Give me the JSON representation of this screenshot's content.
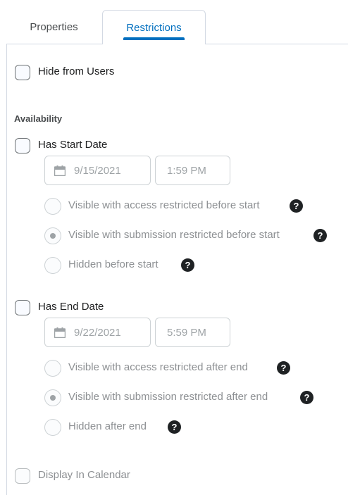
{
  "tabs": {
    "properties": "Properties",
    "restrictions": "Restrictions"
  },
  "hide_from_users": {
    "label": "Hide from Users"
  },
  "availability": {
    "heading": "Availability",
    "start": {
      "label": "Has Start Date",
      "date": "9/15/2021",
      "time": "1:59 PM",
      "options": [
        "Visible with access restricted before start",
        "Visible with submission restricted before start",
        "Hidden before start"
      ],
      "selected_option": 1
    },
    "end": {
      "label": "Has End Date",
      "date": "9/22/2021",
      "time": "5:59 PM",
      "options": [
        "Visible with access restricted after end",
        "Visible with submission restricted after end",
        "Hidden after end"
      ],
      "selected_option": 1
    }
  },
  "display_in_calendar": {
    "label": "Display In Calendar"
  },
  "help_glyph": "?",
  "icons": {
    "calendar": "calendar-icon",
    "help": "help-icon"
  },
  "colors": {
    "accent": "#006fbf",
    "border": "#d3d9e3",
    "disabled_text": "#8d9093"
  }
}
